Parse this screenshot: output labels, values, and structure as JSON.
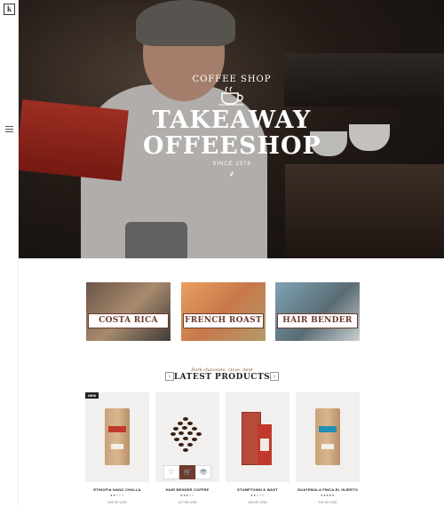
{
  "site": {
    "logo_letter": "k",
    "icons": {
      "menu": "hamburger-icon",
      "cup": "coffee-cup-icon",
      "sprout": "sprout-icon"
    }
  },
  "hero": {
    "kicker": "COFFEE SHOP",
    "title_line1": "TAKEAWAY",
    "title_line2": "OFFEESHOP",
    "since": "SINCE 1978"
  },
  "categories": [
    {
      "label": "COSTA RICA"
    },
    {
      "label": "FRENCH ROAST"
    },
    {
      "label": "HAIR BENDER"
    }
  ],
  "latest": {
    "tagline": "Dark chocolate, clove, mint",
    "title": "LATEST PRODUCTS",
    "prev": "‹",
    "next": "›"
  },
  "products": [
    {
      "name": "ETHIOPIA NANO CHALLA",
      "badge": "NEW",
      "rating": 2,
      "rating_text": "★★☆☆☆",
      "price": "105.00 USD",
      "bag_label": "KAVA",
      "stripe_color": "#c0392b"
    },
    {
      "name": "HAIR BENDER COFFEE",
      "rating": 3,
      "rating_text": "★★★☆☆",
      "price": "107.00 USD",
      "actions": {
        "wishlist": "♡",
        "cart": "🛒",
        "view": "👁"
      }
    },
    {
      "name": "STUMPTOWN & WAST",
      "rating": 2,
      "rating_text": "★★☆☆☆",
      "price": "183.00 USD"
    },
    {
      "name": "GUATEMALA FINCA EL INJERTO",
      "rating": 5,
      "rating_text": "★★★★★",
      "price": "115.00 USD",
      "bag_label": "KAVA",
      "stripe_color": "#1f8fb3"
    }
  ],
  "colors": {
    "accent": "#6e3b2c",
    "card_bg": "#f1f0ee"
  }
}
